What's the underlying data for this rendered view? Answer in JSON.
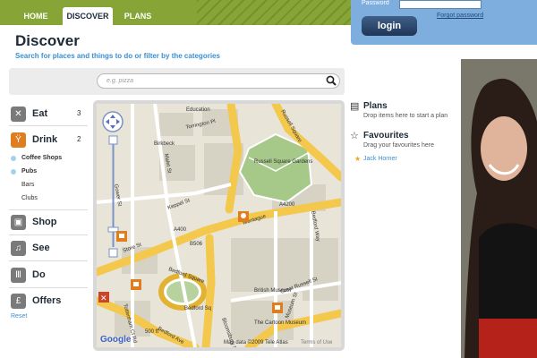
{
  "nav": {
    "tabs": [
      {
        "label": "HOME"
      },
      {
        "label": "DISCOVER"
      },
      {
        "label": "PLANS"
      }
    ]
  },
  "login": {
    "password_label": "Password",
    "forgot_label": "Forgot password",
    "button_label": "login"
  },
  "page": {
    "title": "Discover",
    "subtitle": "Search for places and things to do or filter by the categories"
  },
  "search": {
    "placeholder": "e.g. pizza"
  },
  "categories": [
    {
      "label": "Eat",
      "count": "3",
      "icon": "fork-knife-icon"
    },
    {
      "label": "Drink",
      "count": "2",
      "icon": "glass-icon"
    },
    {
      "label": "Shop",
      "count": "",
      "icon": "bag-icon"
    },
    {
      "label": "See",
      "count": "",
      "icon": "music-note-icon"
    },
    {
      "label": "Do",
      "count": "",
      "icon": "columns-icon"
    },
    {
      "label": "Offers",
      "count": "",
      "icon": "pound-icon"
    }
  ],
  "drink_subcategories": [
    {
      "label": "Coffee Shops",
      "selected": true
    },
    {
      "label": "Pubs",
      "selected": true
    },
    {
      "label": "Bars",
      "selected": false
    },
    {
      "label": "Clubs",
      "selected": false
    }
  ],
  "reset_label": "Reset",
  "map": {
    "labels": [
      "Education",
      "Birkbeck",
      "Russell Square Gardens",
      "Russell Square",
      "Montague",
      "Store St",
      "Keppel St",
      "Malet St",
      "Bedford Square",
      "Bedford Sq",
      "Gower St",
      "Tottenham Ct Rd",
      "Bloomsbury St",
      "Great Russell St",
      "Bedford Ave",
      "Museum St",
      "British Museum",
      "The Cartoon Museum",
      "A400",
      "A4200",
      "B506",
      "Bedford Way",
      "Torrington Pl"
    ],
    "scale_label": "500 ft",
    "copyright": "Map data ©2009 Tele Atlas",
    "terms": "Terms of Use",
    "logo": "Google"
  },
  "plans": {
    "title": "Plans",
    "hint": "Drop items here to start a plan"
  },
  "favourites": {
    "title": "Favourites",
    "hint": "Drag your favourites here",
    "items": [
      "Jack Horner"
    ]
  },
  "colors": {
    "nav_green": "#87a536",
    "login_blue": "#7eaedd",
    "link_blue": "#3a8fd3",
    "drink_orange": "#e07d1e"
  }
}
